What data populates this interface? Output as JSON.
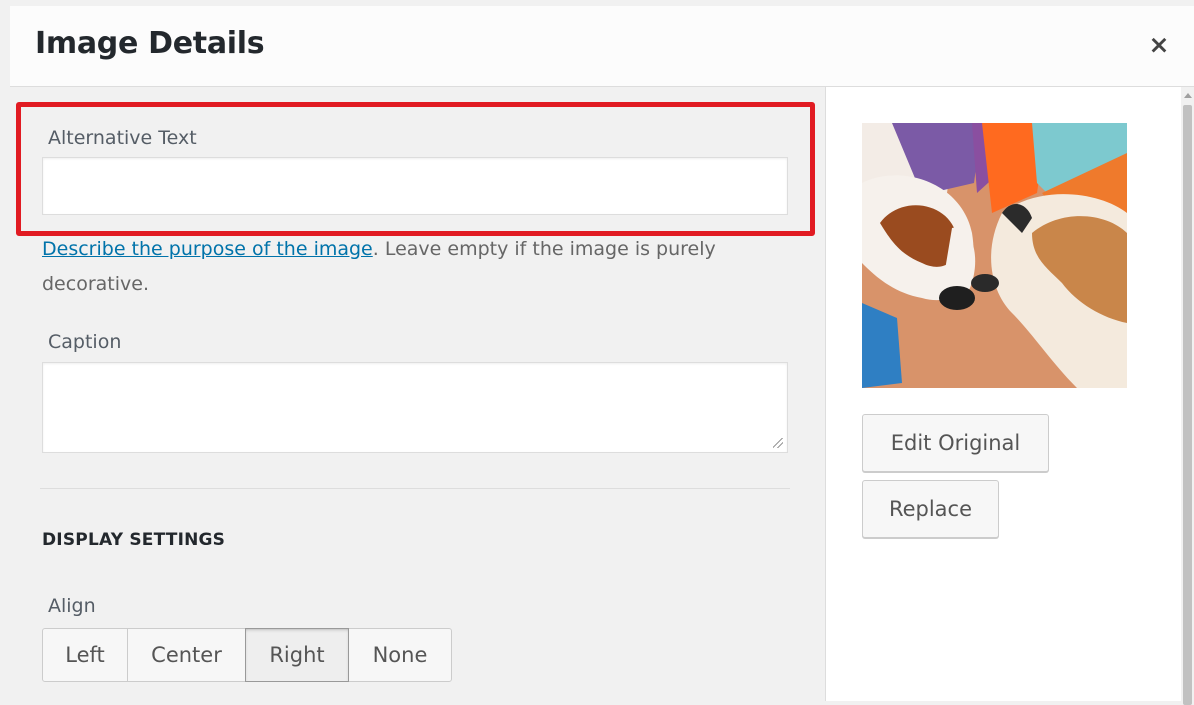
{
  "modal": {
    "title": "Image Details",
    "close_label": "×"
  },
  "form": {
    "alt_text": {
      "label": "Alternative Text",
      "value": "",
      "help_link": "Describe the purpose of the image",
      "help_rest": ". Leave empty if the image is purely decorative."
    },
    "caption": {
      "label": "Caption",
      "value": ""
    },
    "display_settings": {
      "heading": "DISPLAY SETTINGS",
      "align_label": "Align",
      "align_options": [
        "Left",
        "Center",
        "Right",
        "None"
      ],
      "align_selected": "Right"
    }
  },
  "sidebar": {
    "edit_original_label": "Edit Original",
    "replace_label": "Replace"
  },
  "colors": {
    "highlight": "#e11b22",
    "link": "#0073aa",
    "panel_bg": "#f1f1f1"
  }
}
